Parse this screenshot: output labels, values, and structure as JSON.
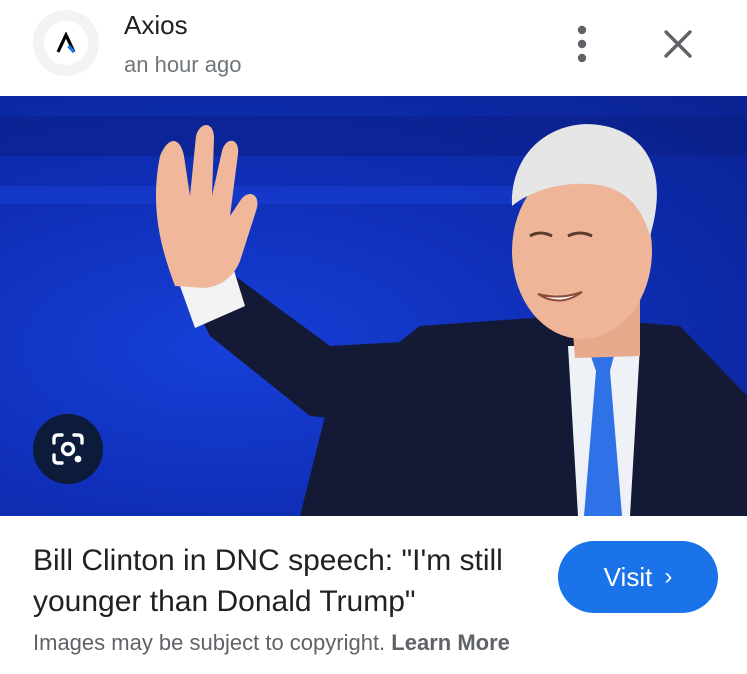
{
  "header": {
    "source_name": "Axios",
    "time": "an hour ago",
    "logo_letter": "A",
    "more_icon": "more-vert-icon",
    "close_icon": "close-icon"
  },
  "image": {
    "lens_icon": "lens-icon"
  },
  "article": {
    "title": "Bill Clinton in DNC speech: \"I'm still younger than Donald Trump\"",
    "visit_label": "Visit",
    "visit_chevron": "›"
  },
  "footer": {
    "notice": "Images may be subject to copyright.",
    "learn_more": "Learn More"
  },
  "colors": {
    "accent": "#1a73e8",
    "image_bg": "#0f2fb8",
    "lens_bg": "#0d1b3a"
  }
}
